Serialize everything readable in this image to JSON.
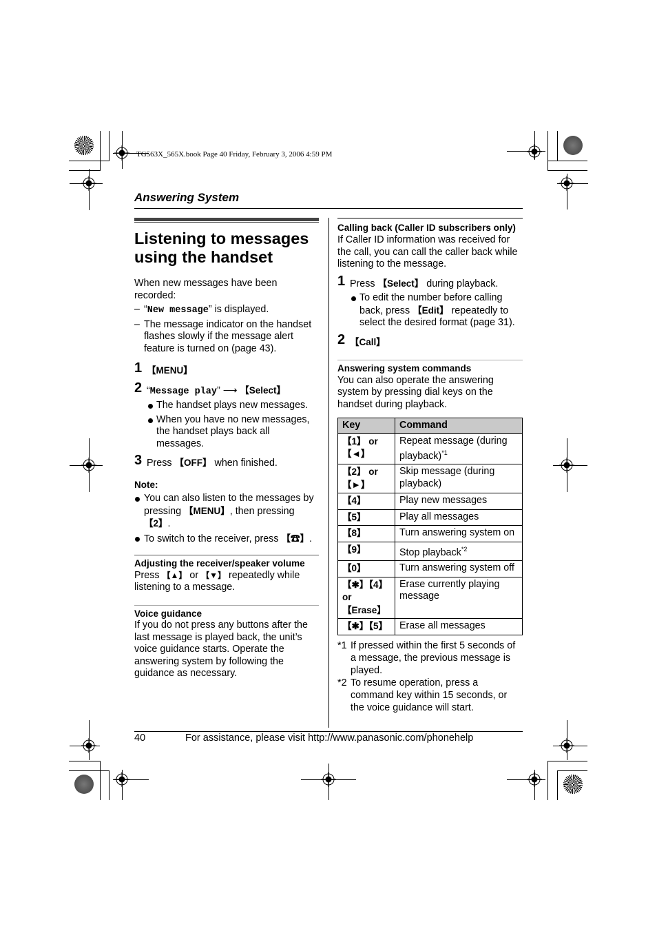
{
  "print_header": "TG563X_565X.book  Page 40  Friday, February 3, 2006  4:59 PM",
  "section_title": "Answering System",
  "left": {
    "title": "Listening to messages using the handset",
    "intro": "When new messages have been recorded:",
    "dash_items": [
      {
        "pre": "“",
        "mono": "New message",
        "post": "” is displayed."
      },
      {
        "text": "The message indicator on the handset flashes slowly if the message alert feature is turned on (page 43)."
      }
    ],
    "steps": [
      {
        "num": "1",
        "key": "【MENU】"
      },
      {
        "num": "2",
        "pre": "“",
        "mono": "Message play",
        "post": "” ",
        "arrow": "⟶",
        "key": "【Select】",
        "bullets": [
          "The handset plays new messages.",
          "When you have no new messages, the handset plays back all messages."
        ]
      },
      {
        "num": "3",
        "pre": "Press ",
        "key": "【OFF】",
        "post": " when finished."
      }
    ],
    "note": {
      "heading": "Note:",
      "items": [
        {
          "pre": "You can also listen to the messages by pressing ",
          "key1": "【MENU】",
          "mid": ", then pressing ",
          "key2": "【2】",
          "post": "."
        },
        {
          "pre": "To switch to the receiver, press ",
          "key": "【☎】",
          "post": "."
        }
      ]
    },
    "volume": {
      "heading": "Adjusting the receiver/speaker volume",
      "pre": "Press ",
      "key1": "【▲】",
      "mid": " or ",
      "key2": "【▼】",
      "post": " repeatedly while listening to a message."
    },
    "voice": {
      "heading": "Voice guidance",
      "text": "If you do not press any buttons after the last message is played back, the unit’s voice guidance starts. Operate the answering system by following the guidance as necessary."
    }
  },
  "right": {
    "callback": {
      "heading": "Calling back (Caller ID subscribers only)",
      "text": "If Caller ID information was received for the call, you can call the caller back while listening to the message.",
      "step1": {
        "num": "1",
        "pre": "Press ",
        "key": "【Select】",
        "post": " during playback.",
        "bullet": {
          "pre": "To edit the number before calling back, press ",
          "key": "【Edit】",
          "post": " repeatedly to select the desired format (page 31)."
        }
      },
      "step2": {
        "num": "2",
        "key": "【Call】"
      }
    },
    "commands": {
      "heading": "Answering system commands",
      "text": "You can also operate the answering system by pressing dial keys on the handset during playback.",
      "table": {
        "headers": [
          "Key",
          "Command"
        ],
        "rows": [
          {
            "key": "【1】 or 【◄】",
            "command": "Repeat message (during playback)",
            "sup": "*1"
          },
          {
            "key": "【2】 or 【►】",
            "command": "Skip message (during playback)",
            "sup": ""
          },
          {
            "key": "【4】",
            "command": "Play new messages",
            "sup": ""
          },
          {
            "key": "【5】",
            "command": "Play all messages",
            "sup": ""
          },
          {
            "key": "【8】",
            "command": "Turn answering system on",
            "sup": ""
          },
          {
            "key": "【9】",
            "command": "Stop playback",
            "sup": "*2"
          },
          {
            "key": "【0】",
            "command": "Turn answering system off",
            "sup": ""
          },
          {
            "key": "【✱】【4】 or 【Erase】",
            "command": "Erase currently playing message",
            "sup": ""
          },
          {
            "key": "【✱】【5】",
            "command": "Erase all messages",
            "sup": ""
          }
        ]
      },
      "footnotes": [
        {
          "mark": "*1",
          "text": "If pressed within the first 5 seconds of a message, the previous message is played."
        },
        {
          "mark": "*2",
          "text": "To resume operation, press a command key within 15 seconds, or the voice guidance will start."
        }
      ]
    }
  },
  "footer": {
    "page_number": "40",
    "text": "For assistance, please visit http://www.panasonic.com/phonehelp"
  }
}
